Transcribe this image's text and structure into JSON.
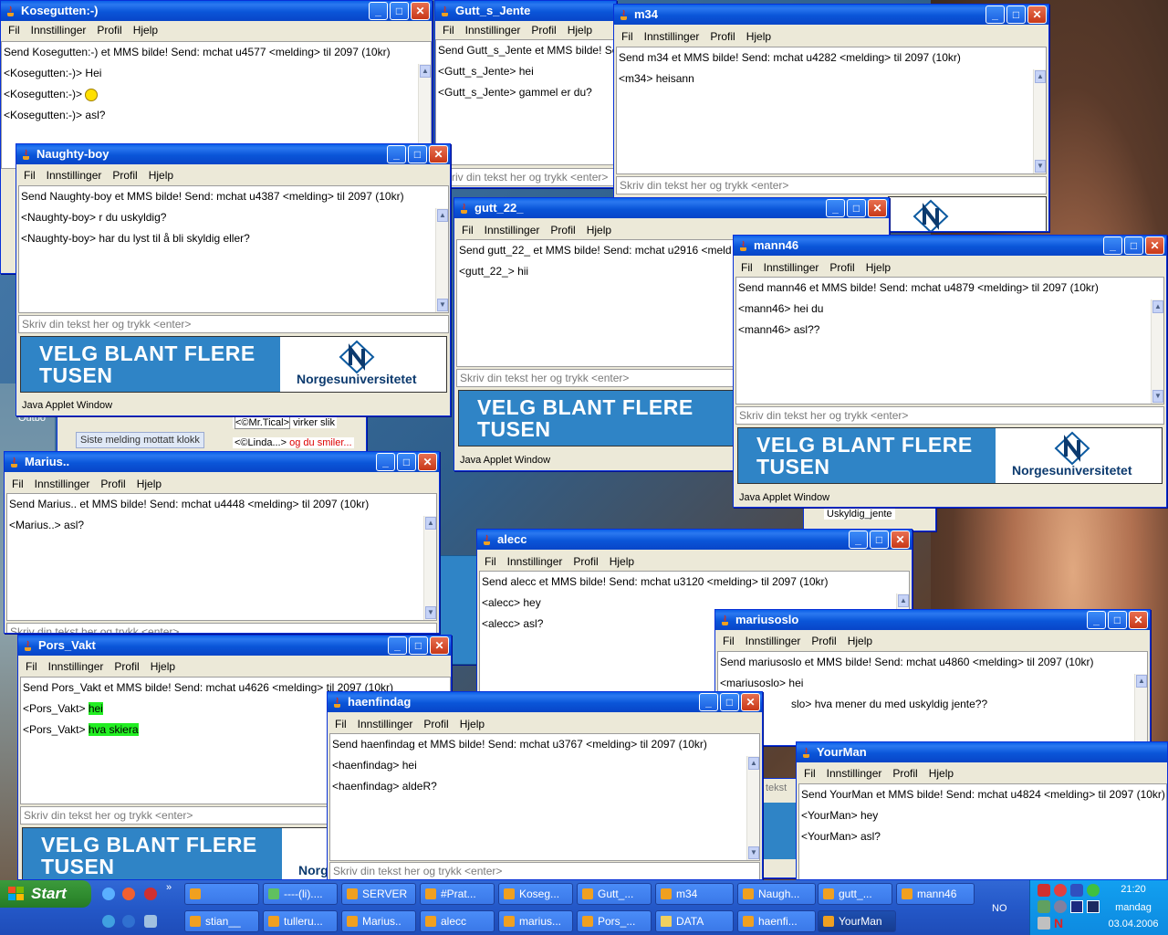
{
  "menu": [
    "Fil",
    "Innstillinger",
    "Profil",
    "Hjelp"
  ],
  "input_placeholder": "Skriv din tekst her og trykk <enter>",
  "applet_status": "Java Applet Window",
  "banner": {
    "line1": "VELG BLANT FLERE",
    "line2": "TUSEN",
    "logo_text": "Norgesuniversitetet"
  },
  "windows": {
    "kosegutten": {
      "title": "Kosegutten:-)",
      "header": "Send Kosegutten:-) et MMS bilde! Send: mchat u4577 <melding> til 2097 (10kr)",
      "messages": [
        {
          "who": "<Kosegutten:-)>",
          "text": "Hei"
        },
        {
          "who": "<Kosegutten:-)>",
          "text": ""
        },
        {
          "who": "<Kosegutten:-)>",
          "text": "asl?"
        }
      ]
    },
    "gutt_s_jente": {
      "title": "Gutt_s_Jente",
      "header": "Send Gutt_s_Jente et MMS bilde! Send: mchat u4",
      "messages": [
        {
          "who": "<Gutt_s_Jente>",
          "text": "hei"
        },
        {
          "who": "<Gutt_s_Jente>",
          "text": "gammel er du?"
        }
      ]
    },
    "m34": {
      "title": "m34",
      "header": "Send m34 et MMS bilde! Send: mchat u4282 <melding> til 2097 (10kr)",
      "messages": [
        {
          "who": "<m34>",
          "text": "heisann"
        }
      ]
    },
    "naughty": {
      "title": "Naughty-boy",
      "header": "Send Naughty-boy et MMS bilde! Send: mchat u4387 <melding> til 2097 (10kr)",
      "messages": [
        {
          "who": "<Naughty-boy>",
          "text": "r du uskyldig?"
        },
        {
          "who": "<Naughty-boy>",
          "text": "har du lyst til å bli skyldig eller?"
        }
      ]
    },
    "gutt22": {
      "title": "gutt_22_",
      "header": "Send gutt_22_ et MMS bilde! Send: mchat u2916 <meld",
      "messages": [
        {
          "who": "<gutt_22_>",
          "text": "hii"
        }
      ]
    },
    "mann46": {
      "title": "mann46",
      "header": "Send mann46 et MMS bilde! Send: mchat u4879 <melding> til 2097 (10kr)",
      "messages": [
        {
          "who": "<mann46>",
          "text": "hei du"
        },
        {
          "who": "<mann46>",
          "text": "asl??"
        }
      ]
    },
    "marius": {
      "title": "Marius..",
      "header": "Send Marius.. et MMS bilde! Send: mchat u4448 <melding> til 2097 (10kr)",
      "messages": [
        {
          "who": "<Marius..>",
          "text": "asl?"
        }
      ]
    },
    "alecc": {
      "title": "alecc",
      "header": "Send alecc et MMS bilde! Send: mchat u3120 <melding> til 2097 (10kr)",
      "messages": [
        {
          "who": "<alecc>",
          "text": "hey"
        },
        {
          "who": "<alecc>",
          "text": "asl?"
        }
      ]
    },
    "mariusoslo": {
      "title": "mariusoslo",
      "header": "Send mariusoslo et MMS bilde! Send: mchat u4860 <melding> til 2097 (10kr)",
      "messages": [
        {
          "who": "<mariusoslo>",
          "text": "hei"
        },
        {
          "who": "slo>",
          "text": "hva mener du med uskyldig jente??"
        }
      ]
    },
    "pors": {
      "title": "Pors_Vakt",
      "header": "Send Pors_Vakt et MMS bilde! Send: mchat u4626 <melding> til 2097 (10kr)",
      "messages": [
        {
          "who": "<Pors_Vakt>",
          "text": "hei"
        },
        {
          "who": "<Pors_Vakt>",
          "text": "hva skiera"
        }
      ]
    },
    "haenfindag": {
      "title": "haenfindag",
      "header": "Send haenfindag et MMS bilde! Send: mchat u3767 <melding> til 2097 (10kr)",
      "messages": [
        {
          "who": "<haenfindag>",
          "text": "hei"
        },
        {
          "who": "<haenfindag>",
          "text": "aldeR?"
        }
      ]
    },
    "yourman": {
      "title": "YourMan",
      "header": "Send YourMan et MMS bilde! Send: mchat u4824 <melding> til 2097 (10kr)",
      "messages": [
        {
          "who": "<YourMan>",
          "text": "hey"
        },
        {
          "who": "<YourMan>",
          "text": "asl?"
        }
      ]
    }
  },
  "background_fragments": {
    "last_message": "Siste melding mottatt klokk",
    "mr_tical": "<©Mr.Tical>",
    "mr_tical_text": "virker slik",
    "linda": "<©Linda...>",
    "linda_text": "og du smiler...",
    "uskyldig_jente": "Uskyldig_jente",
    "outbo": "Outbo",
    "tekst": "tekst"
  },
  "taskbar": {
    "start": "Start",
    "row1": [
      "",
      "----(li)....",
      "SERVER",
      "#Prat...",
      "Koseg...",
      "Gutt_...",
      "m34",
      "Naugh...",
      "gutt_...",
      "mann46"
    ],
    "row2": [
      "stian__",
      "tulleru...",
      "Marius..",
      "alecc",
      "marius...",
      "Pors_...",
      "DATA",
      "haenfi...",
      "YourMan"
    ],
    "language": "NO",
    "time": "21:20",
    "day": "mandag",
    "date": "03.04.2006"
  },
  "colors": {
    "titlebar": "#0a55d8",
    "banner": "#2f84c6",
    "taskbar": "#2458c8",
    "start": "#2e8a2e",
    "highlight": "#22ee22"
  }
}
